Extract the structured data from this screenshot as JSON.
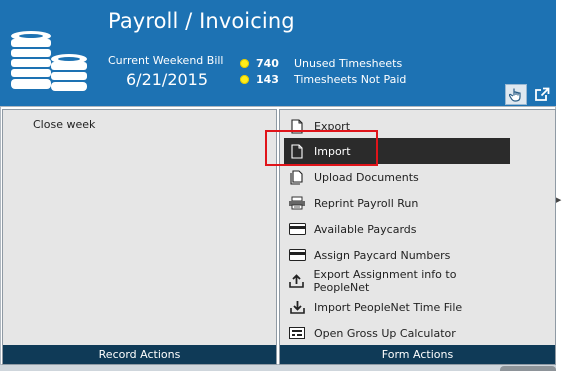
{
  "header": {
    "title": "Payroll / Invoicing",
    "bill_label": "Current Weekend Bill",
    "bill_date": "6/21/2015",
    "stats": [
      {
        "count": "740",
        "label": "Unused Timesheets"
      },
      {
        "count": "143",
        "label": "Timesheets Not Paid"
      }
    ],
    "colors": {
      "background": "#1d72b3",
      "dot": "#ffec1a"
    }
  },
  "record_actions": {
    "items": [
      {
        "label": "Close week"
      }
    ],
    "footer": "Record Actions"
  },
  "form_actions": {
    "items": [
      {
        "label": "Export",
        "icon": "document-icon"
      },
      {
        "label": "Import",
        "icon": "document-icon",
        "selected": true
      },
      {
        "label": "Upload Documents",
        "icon": "documents-icon"
      },
      {
        "label": "Reprint Payroll Run",
        "icon": "printer-icon"
      },
      {
        "label": "Available Paycards",
        "icon": "card-icon"
      },
      {
        "label": "Assign Paycard Numbers",
        "icon": "card-icon"
      },
      {
        "label": "Export Assignment info to PeopleNet",
        "icon": "upload-tray-icon"
      },
      {
        "label": "Import PeopleNet Time File",
        "icon": "download-tray-icon"
      },
      {
        "label": "Open Gross Up Calculator",
        "icon": "calculator-icon"
      }
    ],
    "footer": "Form Actions"
  }
}
